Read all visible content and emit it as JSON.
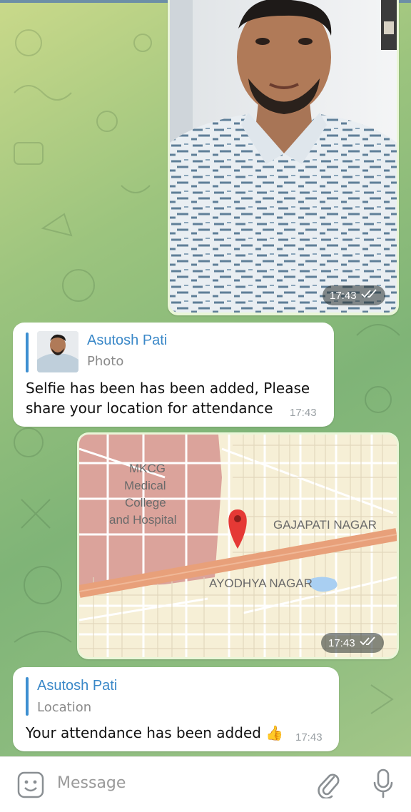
{
  "messages": {
    "selfie": {
      "time": "17:43",
      "status": "read"
    },
    "reply1": {
      "quoted_name": "Asutosh Pati",
      "quoted_type": "Photo",
      "text_line1": "Selfie has been has been added, Please",
      "text_line2": "share your location for attendance",
      "time": "17:43"
    },
    "map": {
      "labels": {
        "mkcg1": "MKCG",
        "mkcg2": "Medical",
        "mkcg3": "College",
        "mkcg4": "and Hospital",
        "gajapati": "GAJAPATI NAGAR",
        "ayodhya": "AYODHYA NAGAR"
      },
      "time": "17:43",
      "status": "read"
    },
    "reply2": {
      "quoted_name": "Asutosh Pati",
      "quoted_type": "Location",
      "text": "Your attendance has been added 👍",
      "time": "17:43"
    }
  },
  "input": {
    "placeholder": "Message",
    "icons": [
      "emoji-icon",
      "attach-icon",
      "mic-icon"
    ]
  },
  "colors": {
    "reply_accent": "#3d8fd1",
    "outgoing_bubble": "#eaf6d8",
    "map_road": "#e8a07a",
    "map_pin": "#e53935"
  }
}
